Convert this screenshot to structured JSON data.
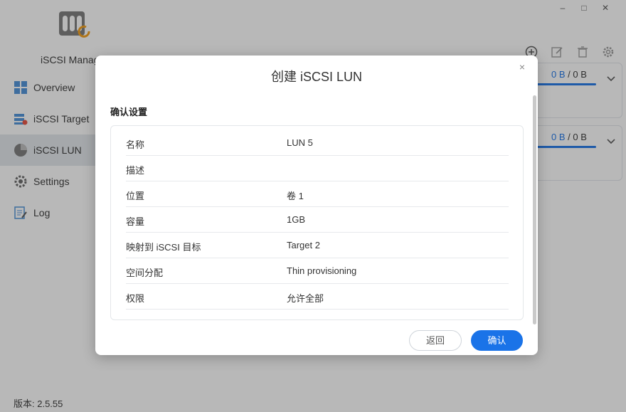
{
  "app": {
    "name": "iSCSI Manager",
    "version": "版本: 2.5.55"
  },
  "window_controls": {
    "minimize": "–",
    "maximize": "□",
    "close": "✕"
  },
  "nav": [
    {
      "label": "Overview",
      "icon": "overview-icon"
    },
    {
      "label": "iSCSI Target",
      "icon": "target-icon"
    },
    {
      "label": "iSCSI LUN",
      "icon": "lun-icon",
      "active": true
    },
    {
      "label": "Settings",
      "icon": "gear-icon"
    },
    {
      "label": "Log",
      "icon": "log-icon"
    }
  ],
  "toolbar": [
    "add-icon",
    "edit-icon",
    "delete-icon",
    "gear-icon"
  ],
  "cards": [
    {
      "usage_used": "0 B",
      "usage_sep": " / ",
      "usage_total": "0 B"
    },
    {
      "usage_used": "0 B",
      "usage_sep": " / ",
      "usage_total": "0 B"
    }
  ],
  "modal": {
    "title": "创建 iSCSI LUN",
    "close": "×",
    "section_title": "确认设置",
    "rows": [
      {
        "key": "名称",
        "value": "LUN 5"
      },
      {
        "key": "描述",
        "value": ""
      },
      {
        "key": "位置",
        "value": "卷 1"
      },
      {
        "key": "容量",
        "value": "1GB"
      },
      {
        "key": "映射到 iSCSI 目标",
        "value": "Target 2"
      },
      {
        "key": "空间分配",
        "value": "Thin provisioning"
      },
      {
        "key": "权限",
        "value": "允许全部"
      }
    ],
    "back_label": "返回",
    "ok_label": "确认"
  },
  "colors": {
    "accent": "#1a73e8",
    "overlay": "#555555"
  }
}
